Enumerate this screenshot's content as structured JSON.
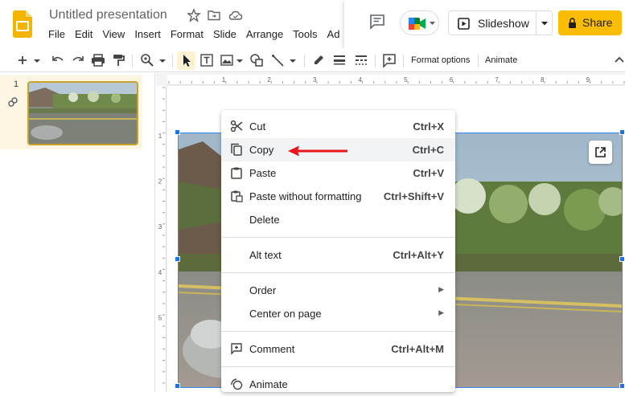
{
  "header": {
    "doc_title": "Untitled presentation",
    "menus": [
      "File",
      "Edit",
      "View",
      "Insert",
      "Format",
      "Slide",
      "Arrange",
      "Tools",
      "Ad"
    ],
    "slideshow_label": "Slideshow",
    "share_label": "Share"
  },
  "toolbar": {
    "format_options_label": "Format options",
    "animate_label": "Animate"
  },
  "filmstrip": {
    "slide_number": "1"
  },
  "ruler": {
    "h_ticks": [
      "1",
      "2",
      "3",
      "4",
      "5",
      "6",
      "7",
      "8",
      "9"
    ],
    "v_ticks": [
      "1",
      "2",
      "3",
      "4",
      "5"
    ]
  },
  "context_menu": {
    "items": [
      {
        "label": "Cut",
        "shortcut": "Ctrl+X",
        "icon": "scissors-icon"
      },
      {
        "label": "Copy",
        "shortcut": "Ctrl+C",
        "icon": "copy-icon"
      },
      {
        "label": "Paste",
        "shortcut": "Ctrl+V",
        "icon": "paste-icon"
      },
      {
        "label": "Paste without formatting",
        "shortcut": "Ctrl+Shift+V",
        "icon": "paste-plain-icon"
      },
      {
        "label": "Delete",
        "shortcut": ""
      },
      {
        "label": "Alt text",
        "shortcut": "Ctrl+Alt+Y"
      },
      {
        "label": "Order",
        "submenu": true
      },
      {
        "label": "Center on page",
        "submenu": true
      },
      {
        "label": "Comment",
        "shortcut": "Ctrl+Alt+M",
        "icon": "add-comment-icon"
      },
      {
        "label": "Animate",
        "icon": "animate-icon"
      }
    ]
  },
  "colors": {
    "accent": "#1a73e8",
    "share": "#fbbc04",
    "selected_thumb": "#fdf6e3",
    "annotation_arrow": "#e8161b"
  }
}
